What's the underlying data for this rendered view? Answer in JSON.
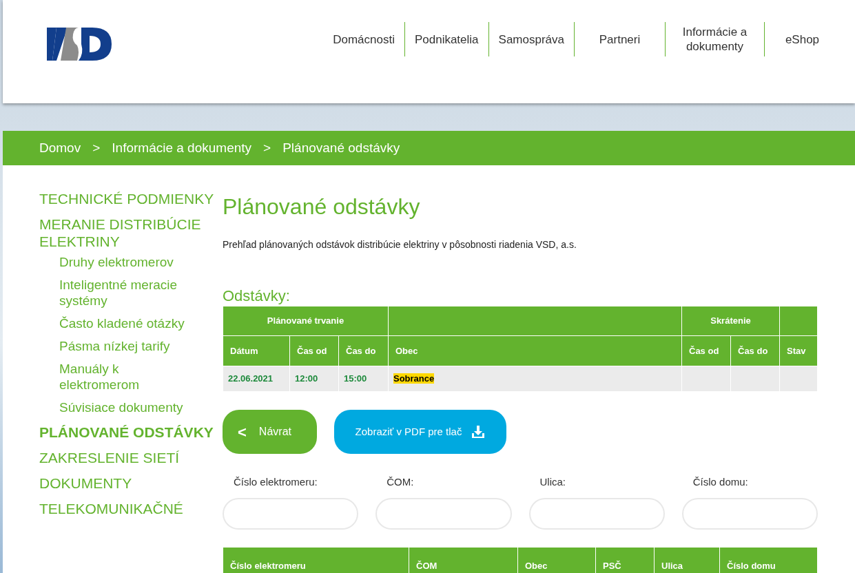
{
  "header": {
    "nav": [
      {
        "label": "Domácnosti"
      },
      {
        "label": "Podnikatelia"
      },
      {
        "label": "Samospráva"
      },
      {
        "label": "Partneri"
      },
      {
        "label": "Informácie a dokumenty"
      },
      {
        "label": "eShop"
      }
    ]
  },
  "breadcrumb": [
    {
      "label": "Domov"
    },
    {
      "label": "Informácie a dokumenty"
    },
    {
      "label": "Plánované odstávky"
    }
  ],
  "breadcrumb_separator": ">",
  "sidebar": {
    "items": [
      {
        "label": "TECHNICKÉ PODMIENKY",
        "selected": false
      },
      {
        "label": "MERANIE DISTRIBÚCIE ELEKTRINY",
        "selected": false,
        "children": [
          {
            "label": "Druhy elektromerov"
          },
          {
            "label": "Inteligentné meracie systémy"
          },
          {
            "label": "Často kladené otázky"
          },
          {
            "label": "Pásma nízkej tarify"
          },
          {
            "label": "Manuály k elektromerom"
          },
          {
            "label": "Súvisiace dokumenty"
          }
        ]
      },
      {
        "label": "PLÁNOVANÉ ODSTÁVKY",
        "selected": true
      },
      {
        "label": "ZAKRESLENIE SIETÍ",
        "selected": false
      },
      {
        "label": "DOKUMENTY",
        "selected": false
      },
      {
        "label": "TELEKOMUNIKAČNÉ",
        "selected": false
      }
    ]
  },
  "page_title": "Plánované odstávky",
  "intro": "Prehľad plánovaných odstávok distribúcie elektriny v pôsobnosti riadenia VSD, a.s.",
  "outages": {
    "heading": "Odstávky:",
    "group_headers": [
      {
        "kind": "planned",
        "label": "Plánované trvanie"
      },
      {
        "kind": "blank"
      },
      {
        "kind": "shortening",
        "label": "Skrátenie"
      },
      {
        "kind": "blank"
      }
    ],
    "columns": [
      "Dátum",
      "Čas od",
      "Čas do",
      "Obec",
      "Čas od",
      "Čas do",
      "Stav"
    ],
    "rows": [
      {
        "date": "22.06.2021",
        "time_from": "12:00",
        "time_to": "15:00",
        "town": "Sobrance",
        "town_highlighted": true
      }
    ]
  },
  "buttons": [
    {
      "kind": "back",
      "label": "Návrat",
      "icon": "<"
    },
    {
      "kind": "pdf",
      "label": "Zobraziť v PDF pre tlač"
    }
  ],
  "filters": [
    {
      "label": "Číslo elektromeru:"
    },
    {
      "label": "ČOM:"
    },
    {
      "label": "Ulica:"
    },
    {
      "label": "Číslo domu:"
    }
  ],
  "meters_table": {
    "columns": [
      "Číslo elektromeru",
      "ČOM",
      "Obec",
      "PSČ",
      "Ulica",
      "Číslo domu"
    ]
  }
}
